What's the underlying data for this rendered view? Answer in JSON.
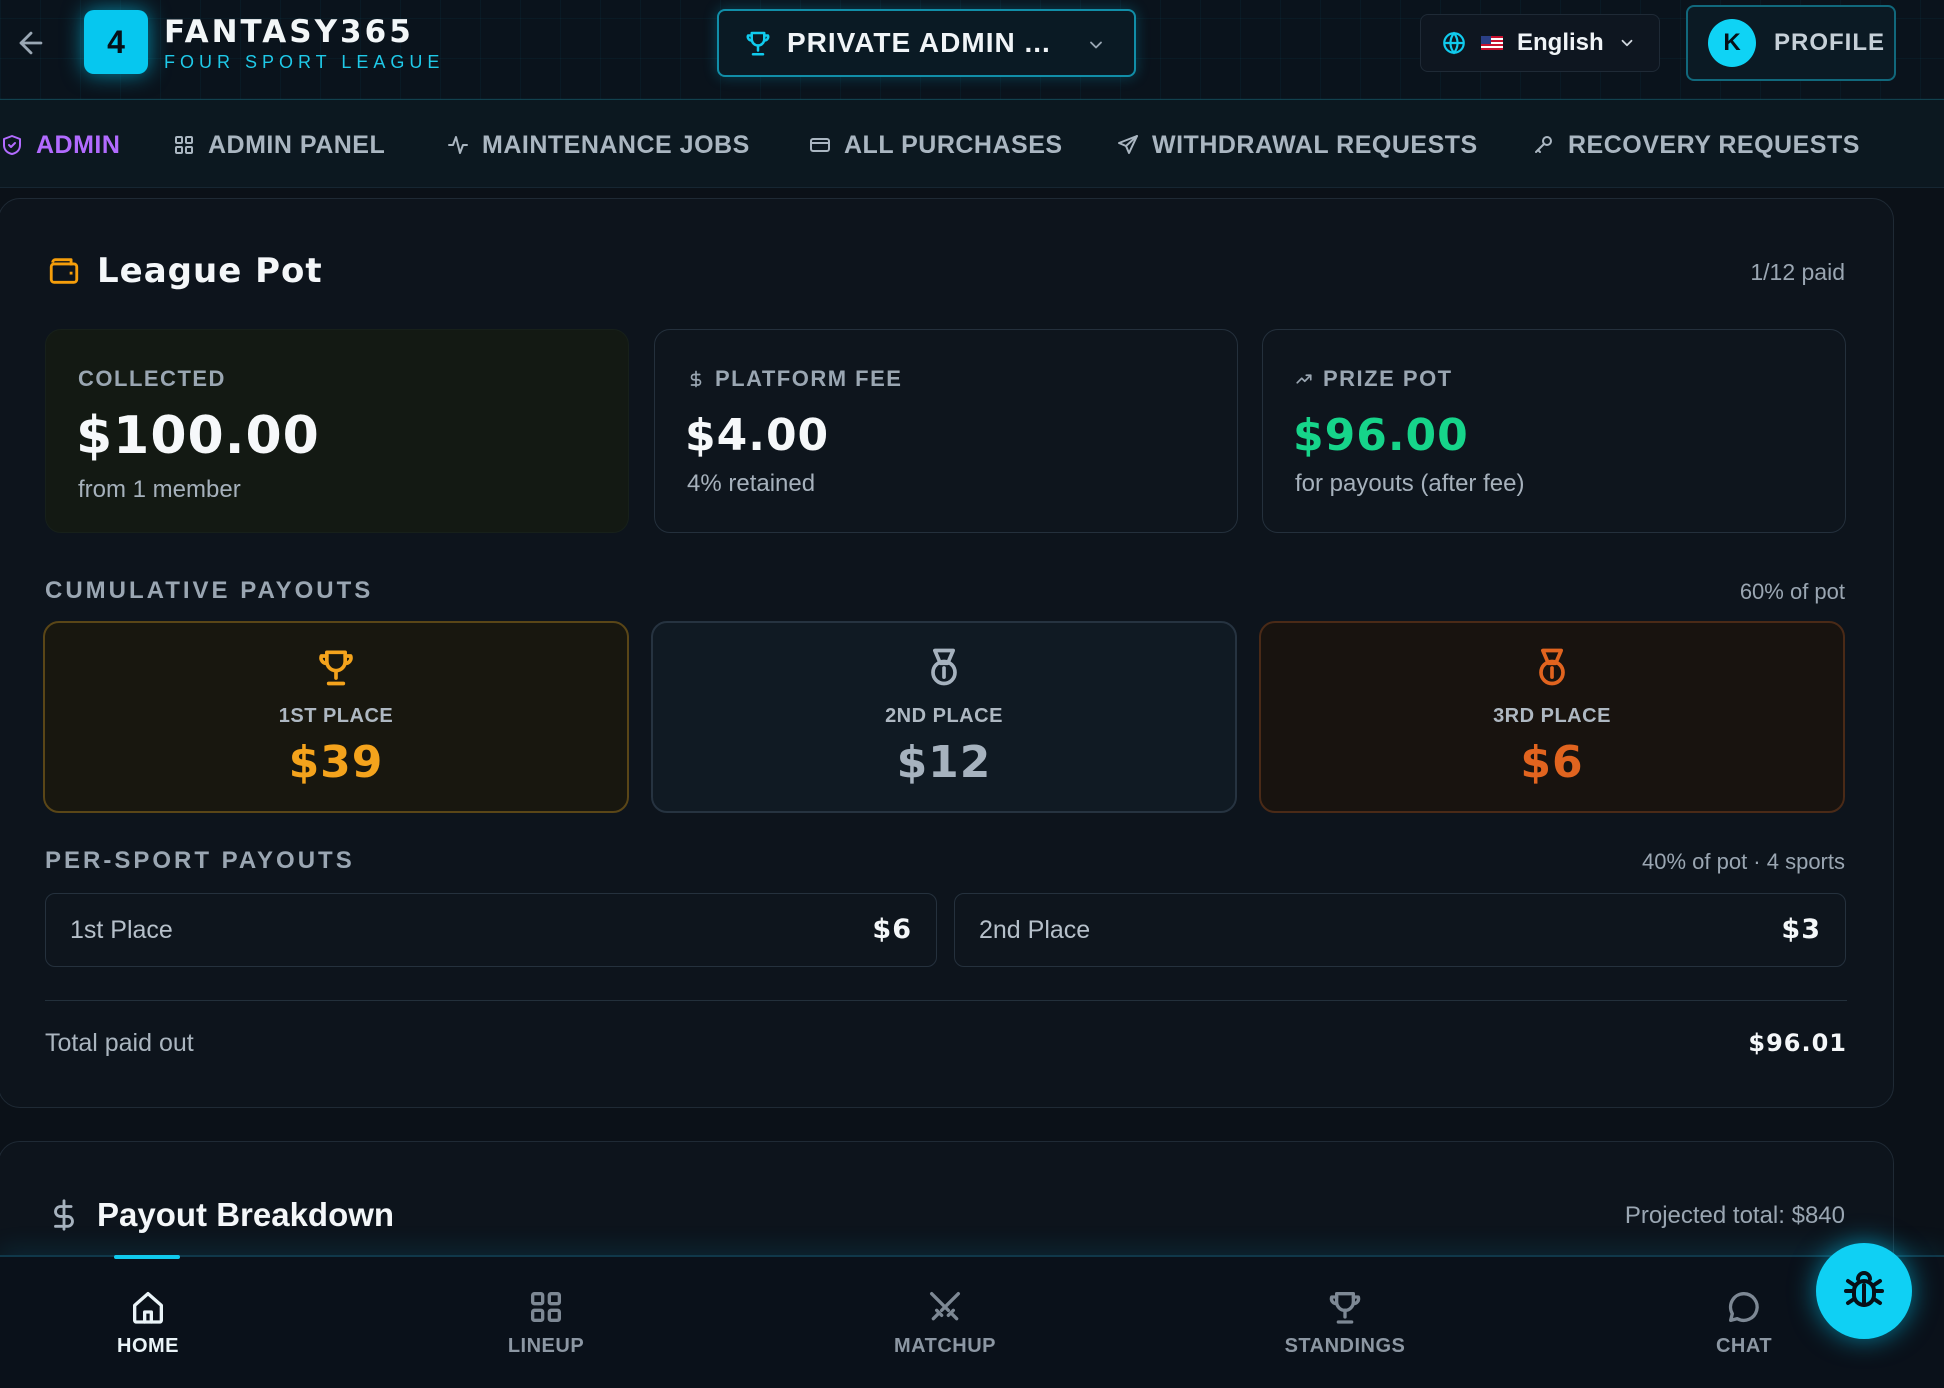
{
  "header": {
    "logo_number": "4",
    "brand_title": "FANTASY365",
    "brand_subtitle": "FOUR SPORT LEAGUE",
    "league_selector": "PRIVATE ADMIN ...",
    "language": "English",
    "profile_initial": "K",
    "profile_label": "PROFILE"
  },
  "admin_nav": {
    "items": [
      {
        "label": "ADMIN",
        "icon": "shield-icon",
        "active": true
      },
      {
        "label": "ADMIN PANEL",
        "icon": "grid-icon"
      },
      {
        "label": "MAINTENANCE JOBS",
        "icon": "activity-icon"
      },
      {
        "label": "ALL PURCHASES",
        "icon": "credit-card-icon"
      },
      {
        "label": "WITHDRAWAL REQUESTS",
        "icon": "send-icon"
      },
      {
        "label": "RECOVERY REQUESTS",
        "icon": "key-icon"
      }
    ]
  },
  "league_pot": {
    "title": "League Pot",
    "paid_status": "1/12 paid",
    "collected": {
      "label": "COLLECTED",
      "value": "$100.00",
      "note": "from 1 member"
    },
    "platform_fee": {
      "label": "PLATFORM FEE",
      "value": "$4.00",
      "note": "4% retained"
    },
    "prize_pot": {
      "label": "PRIZE POT",
      "value": "$96.00",
      "note": "for payouts (after fee)"
    },
    "cumulative": {
      "label": "CUMULATIVE PAYOUTS",
      "share": "60% of pot",
      "places": [
        {
          "label": "1ST PLACE",
          "amount": "$39",
          "icon": "trophy-icon"
        },
        {
          "label": "2ND PLACE",
          "amount": "$12",
          "icon": "medal-icon"
        },
        {
          "label": "3RD PLACE",
          "amount": "$6",
          "icon": "medal-icon"
        }
      ]
    },
    "per_sport": {
      "label": "PER-SPORT PAYOUTS",
      "share": "40% of pot · 4 sports",
      "rows": [
        {
          "label": "1st Place",
          "amount": "$6"
        },
        {
          "label": "2nd Place",
          "amount": "$3"
        }
      ]
    },
    "total_label": "Total paid out",
    "total_value": "$96.01"
  },
  "payout_breakdown": {
    "title": "Payout Breakdown",
    "projected": "Projected total: $840"
  },
  "bottom_nav": {
    "tabs": [
      {
        "label": "HOME",
        "icon": "home-icon",
        "active": true
      },
      {
        "label": "LINEUP",
        "icon": "grid-icon"
      },
      {
        "label": "MATCHUP",
        "icon": "swords-icon"
      },
      {
        "label": "STANDINGS",
        "icon": "trophy-icon"
      },
      {
        "label": "CHAT",
        "icon": "chat-icon"
      }
    ]
  },
  "colors": {
    "accent": "#0fd0f4",
    "admin_purple": "#b26bff",
    "gold": "#f4a31c",
    "silver": "#a6b2be",
    "bronze": "#e1641f",
    "green": "#16d48a"
  }
}
